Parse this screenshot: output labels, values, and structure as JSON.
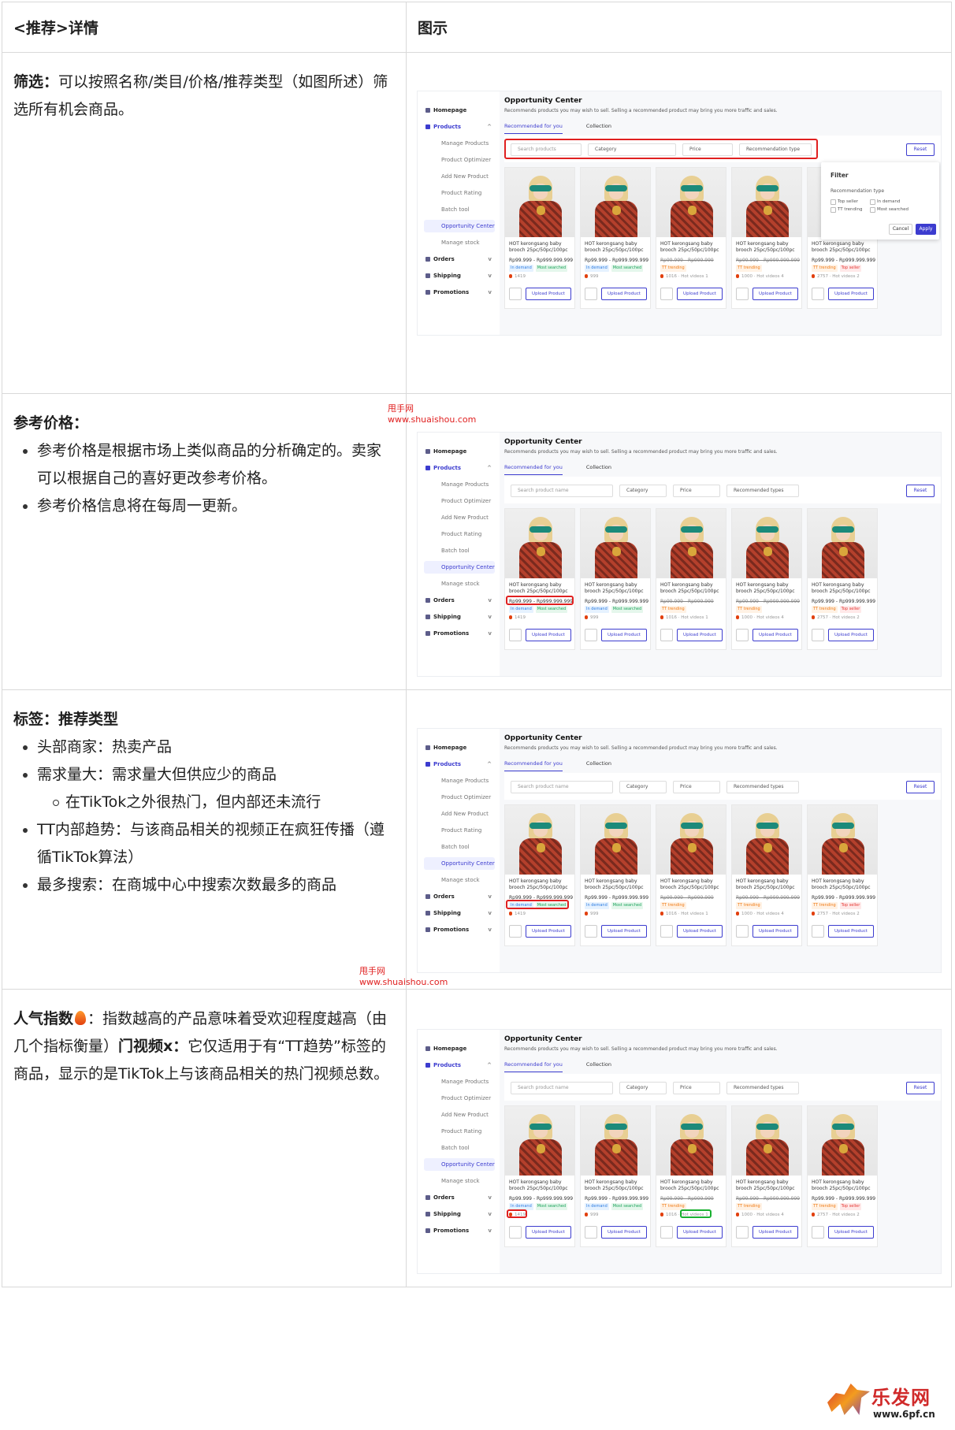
{
  "header": {
    "col1": "<推荐>详情",
    "col2": "图示"
  },
  "rows": [
    {
      "bold": "筛选：",
      "text": "可以按照名称/类目/价格/推荐类型（如图所述）筛选所有机会商品。"
    },
    {
      "bold": "参考价格：",
      "bullets": [
        "参考价格是根据市场上类似商品的分析确定的。卖家可以根据自己的喜好更改参考价格。",
        "参考价格信息将在每周一更新。"
      ]
    },
    {
      "bold": "标签：推荐类型",
      "bullets": [
        "头部商家：热卖产品",
        "需求量大：需求量大但供应少的商品",
        "TT内部趋势：与该商品相关的视频正在疯狂传播（遵循TikTok算法）",
        "最多搜索：在商城中心中搜索次数最多的商品"
      ],
      "sub": "在TikTok之外很热门，但内部还未流行"
    },
    {
      "bold1": "人气指数",
      "text1": "：指数越高的产品意味着受欢迎程度越高（由几个指标衡量）",
      "bold2": "门视频x：",
      "text2": "它仅适用于有“TT趋势”标签的商品，显示的是TikTok上与该商品相关的热门视频总数。"
    }
  ],
  "watermark": {
    "line1": "甩手网",
    "line2": "www.shuaishou.com"
  },
  "logo": {
    "text": "乐发网",
    "url": "www.6pf.cn"
  },
  "mock": {
    "title": "Opportunity Center",
    "subtitle": "Recommends products you may wish to sell. Selling a recommended product may bring you more traffic and sales.",
    "tabs": [
      "Recommended for you",
      "Collection"
    ],
    "nav": {
      "homepage": "Homepage",
      "products": "Products",
      "sub": [
        "Manage Products",
        "Product Optimizer",
        "Add New Product",
        "Product Rating",
        "Batch tool",
        "Opportunity Center",
        "Manage stock"
      ],
      "orders": "Orders",
      "shipping": "Shipping",
      "promotions": "Promotions"
    },
    "filters1": {
      "search": "Search products",
      "category": "Category",
      "price": "Price",
      "type": "Recommendation type"
    },
    "filters2": {
      "search": "Search product name",
      "category": "Category",
      "price": "Price",
      "type": "Recommended types"
    },
    "reset": "Reset",
    "filter_panel": {
      "title": "Filter",
      "section": "Recommendation type",
      "options": [
        "Top seller",
        "In demand",
        "TT trending",
        "Most searched"
      ],
      "cancel": "Cancel",
      "apply": "Apply"
    },
    "product_name": "HOT kerongsang baby brooch 25pc/50pc/100pc",
    "prices": [
      "Rp99.999 - Rp999.999.999",
      "Rp99.999 - Rp999.999.999",
      "Rp99.999 - Rp999.999",
      "Rp99.999 - Rp999.999.999",
      "Rp99.999 - Rp999.999.999"
    ],
    "tags": [
      [
        "In demand",
        "Most searched"
      ],
      [
        "In demand",
        "Most searched"
      ],
      [
        "TT trending"
      ],
      [
        "TT trending"
      ],
      [
        "TT trending",
        "Top seller"
      ]
    ],
    "pop": [
      "1419",
      "999",
      "1016 · Hot videos 1",
      "1000 · Hot videos 4",
      "2757 · Hot videos 2"
    ],
    "upload": "Upload Product"
  },
  "colors": {
    "accent": "#3c3ccf",
    "highlight": "#e02020",
    "highlight_green": "#19b030"
  }
}
